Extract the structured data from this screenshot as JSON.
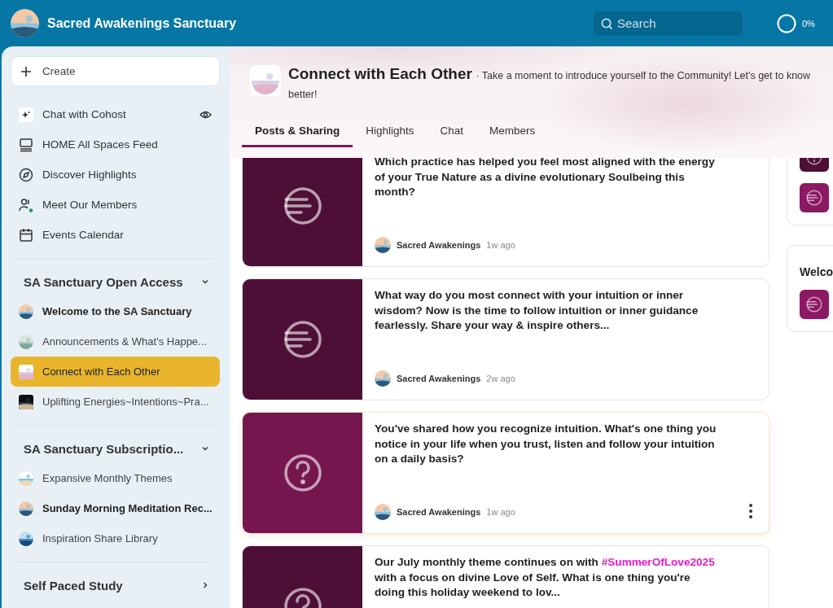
{
  "topbar": {
    "title": "Sacred Awakenings Sanctuary",
    "search": {
      "placeholder": "Search"
    },
    "progress": {
      "label": "0%"
    }
  },
  "sidebar": {
    "create": "Create",
    "nav": [
      {
        "kind": "sparkle",
        "label": "Chat with Cohost",
        "watch": true
      },
      {
        "kind": "monitor",
        "label": "HOME All Spaces Feed",
        "watch": false
      },
      {
        "kind": "compass",
        "label": "Discover Highlights",
        "watch": false
      },
      {
        "kind": "people",
        "label": "Meet Our Members",
        "watch": false
      },
      {
        "kind": "calendar",
        "label": "Events Calendar",
        "watch": false
      }
    ],
    "sections": [
      {
        "title": "SA Sanctuary Open Access",
        "expanded": true,
        "items": [
          {
            "label": "Welcome to the SA Sanctuary",
            "unread": true,
            "selected": false
          },
          {
            "label": "Announcements & What's Happe...",
            "unread": false,
            "selected": false
          },
          {
            "label": "Connect with Each Other",
            "unread": false,
            "selected": true
          },
          {
            "label": "Uplifting Energies~Intentions~Pra...",
            "unread": false,
            "selected": false
          }
        ]
      },
      {
        "title": "SA Sanctuary Subscriptio...",
        "expanded": true,
        "items": [
          {
            "label": "Expansive Monthly Themes",
            "unread": false,
            "selected": false
          },
          {
            "label": "Sunday Morning Meditation Rec...",
            "unread": true,
            "selected": false
          },
          {
            "label": "Inspiration Share Library",
            "unread": false,
            "selected": false
          }
        ]
      },
      {
        "title": "Self Paced Study",
        "expanded": false
      }
    ]
  },
  "space": {
    "title": "Connect with Each Other",
    "description": "· Take a moment to introduce yourself to the Community! Let's get to know better!",
    "tabs": [
      {
        "label": "Posts & Sharing",
        "selected": true
      },
      {
        "label": "Highlights",
        "selected": false
      },
      {
        "label": "Chat",
        "selected": false
      },
      {
        "label": "Members",
        "selected": false
      }
    ]
  },
  "posts": [
    {
      "kind": "lines",
      "color": "#4e0f36",
      "body": [
        {
          "kind": "text",
          "text": "Which practice has helped you feel most aligned with the energy of your True Nature as a divine evolutionary Soulbeing this month?"
        }
      ],
      "author": "Sacred Awakenings",
      "time": "1w ago",
      "hovered": false
    },
    {
      "kind": "lines",
      "color": "#4e0f36",
      "body": [
        {
          "kind": "text",
          "text": "What way do you most connect with your intuition or inner wisdom? Now is the time to follow intuition or inner guidance fearlessly. Share your way & inspire others..."
        }
      ],
      "author": "Sacred Awakenings",
      "time": "2w ago",
      "hovered": false
    },
    {
      "kind": "question",
      "color": "#75164f",
      "body": [
        {
          "kind": "text",
          "text": "You've shared how you recognize intuition. What's one thing you notice in your life when you trust, listen and follow your intuition on a daily basis?"
        }
      ],
      "author": "Sacred Awakenings",
      "time": "1w ago",
      "hovered": true
    },
    {
      "kind": "question",
      "color": "#4e0f36",
      "body": [
        {
          "kind": "text",
          "text": "Our July monthly theme continues on with "
        },
        {
          "kind": "hashtag",
          "text": "#SummerOfLove2025"
        },
        {
          "kind": "text",
          "text": " with a focus on divine Love of Self. What is one thing you're doing this holiday weekend to lov..."
        }
      ],
      "hovered": false
    }
  ],
  "side_cards": [
    {
      "thumbs": [
        {
          "kind": "question",
          "color": "#4e0f36"
        },
        {
          "kind": "lines",
          "color": "#8b1a63"
        }
      ]
    },
    {
      "title": "Welco",
      "thumbs": [
        {
          "kind": "lines",
          "color": "#8b1a63"
        }
      ]
    }
  ]
}
